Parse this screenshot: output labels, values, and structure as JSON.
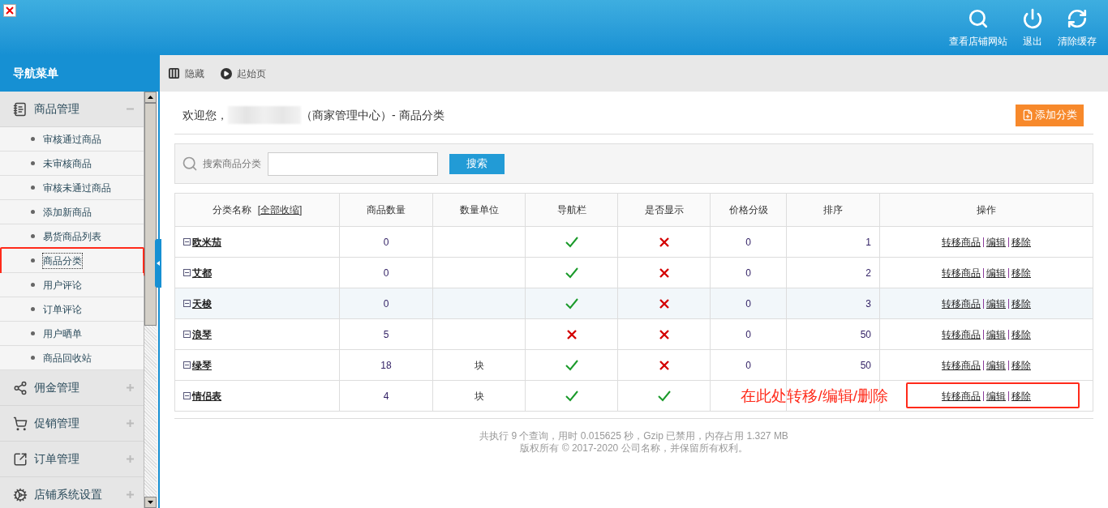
{
  "header": {
    "actions": [
      {
        "kind": "search",
        "label": "查看店铺网站"
      },
      {
        "kind": "power",
        "label": "退出"
      },
      {
        "kind": "refresh",
        "label": "清除缓存"
      }
    ]
  },
  "sidebar": {
    "title": "导航菜单",
    "groups": [
      {
        "kind": "doc",
        "label": "商品管理",
        "expanded": true,
        "items": [
          {
            "label": "审核通过商品",
            "selected": false
          },
          {
            "label": "未审核商品",
            "selected": false
          },
          {
            "label": "审核未通过商品",
            "selected": false
          },
          {
            "label": "添加新商品",
            "selected": false
          },
          {
            "label": "易货商品列表",
            "selected": false
          },
          {
            "label": "商品分类",
            "selected": true
          },
          {
            "label": "用户评论",
            "selected": false
          },
          {
            "label": "订单评论",
            "selected": false
          },
          {
            "label": "用户晒单",
            "selected": false
          },
          {
            "label": "商品回收站",
            "selected": false
          }
        ]
      },
      {
        "kind": "share",
        "label": "佣金管理",
        "expanded": false
      },
      {
        "kind": "cart",
        "label": "促销管理",
        "expanded": false
      },
      {
        "kind": "export",
        "label": "订单管理",
        "expanded": false
      },
      {
        "kind": "gears",
        "label": "店铺系统设置",
        "expanded": false
      }
    ]
  },
  "toolbar": [
    {
      "kind": "hide",
      "label": "隐藏"
    },
    {
      "kind": "play",
      "label": "起始页"
    }
  ],
  "page": {
    "welcome": "欢迎您，",
    "title": "（商家管理中心）- 商品分类",
    "add_button": "添加分类"
  },
  "search": {
    "label": "搜索商品分类",
    "button": "搜索"
  },
  "table": {
    "columns": [
      "分类名称",
      "商品数量",
      "数量单位",
      "导航栏",
      "是否显示",
      "价格分级",
      "排序",
      "操作"
    ],
    "collapse_all": "[全部收缩]",
    "rows": [
      {
        "name": "欧米茄",
        "count": "0",
        "unit": "",
        "nav": true,
        "show": false,
        "grade": "0",
        "sort": "1",
        "highlighted": false,
        "actions": [
          "转移商品",
          "编辑",
          "移除"
        ]
      },
      {
        "name": "艾都",
        "count": "0",
        "unit": "",
        "nav": true,
        "show": false,
        "grade": "0",
        "sort": "2",
        "highlighted": false,
        "actions": [
          "转移商品",
          "编辑",
          "移除"
        ]
      },
      {
        "name": "天梭",
        "count": "0",
        "unit": "",
        "nav": true,
        "show": false,
        "grade": "0",
        "sort": "3",
        "highlighted": true,
        "actions": [
          "转移商品",
          "编辑",
          "移除"
        ]
      },
      {
        "name": "浪琴",
        "count": "5",
        "unit": "",
        "nav": false,
        "show": false,
        "grade": "0",
        "sort": "50",
        "highlighted": false,
        "actions": [
          "转移商品",
          "编辑",
          "移除"
        ]
      },
      {
        "name": "绿琴",
        "count": "18",
        "unit": "块",
        "nav": true,
        "show": false,
        "grade": "0",
        "sort": "50",
        "highlighted": false,
        "actions": [
          "转移商品",
          "编辑",
          "移除"
        ]
      },
      {
        "name": "情侣表",
        "count": "4",
        "unit": "块",
        "nav": true,
        "show": true,
        "grade": "",
        "sort": "",
        "highlighted": false,
        "actions": [
          "转移商品",
          "编辑",
          "移除"
        ]
      }
    ]
  },
  "annotation": "在此处转移/编辑/删除",
  "footer": [
    "共执行 9 个查询，用时 0.015625 秒，Gzip 已禁用，内存占用 1.327 MB",
    "版权所有 © 2017-2020 公司名称，并保留所有权利。"
  ]
}
